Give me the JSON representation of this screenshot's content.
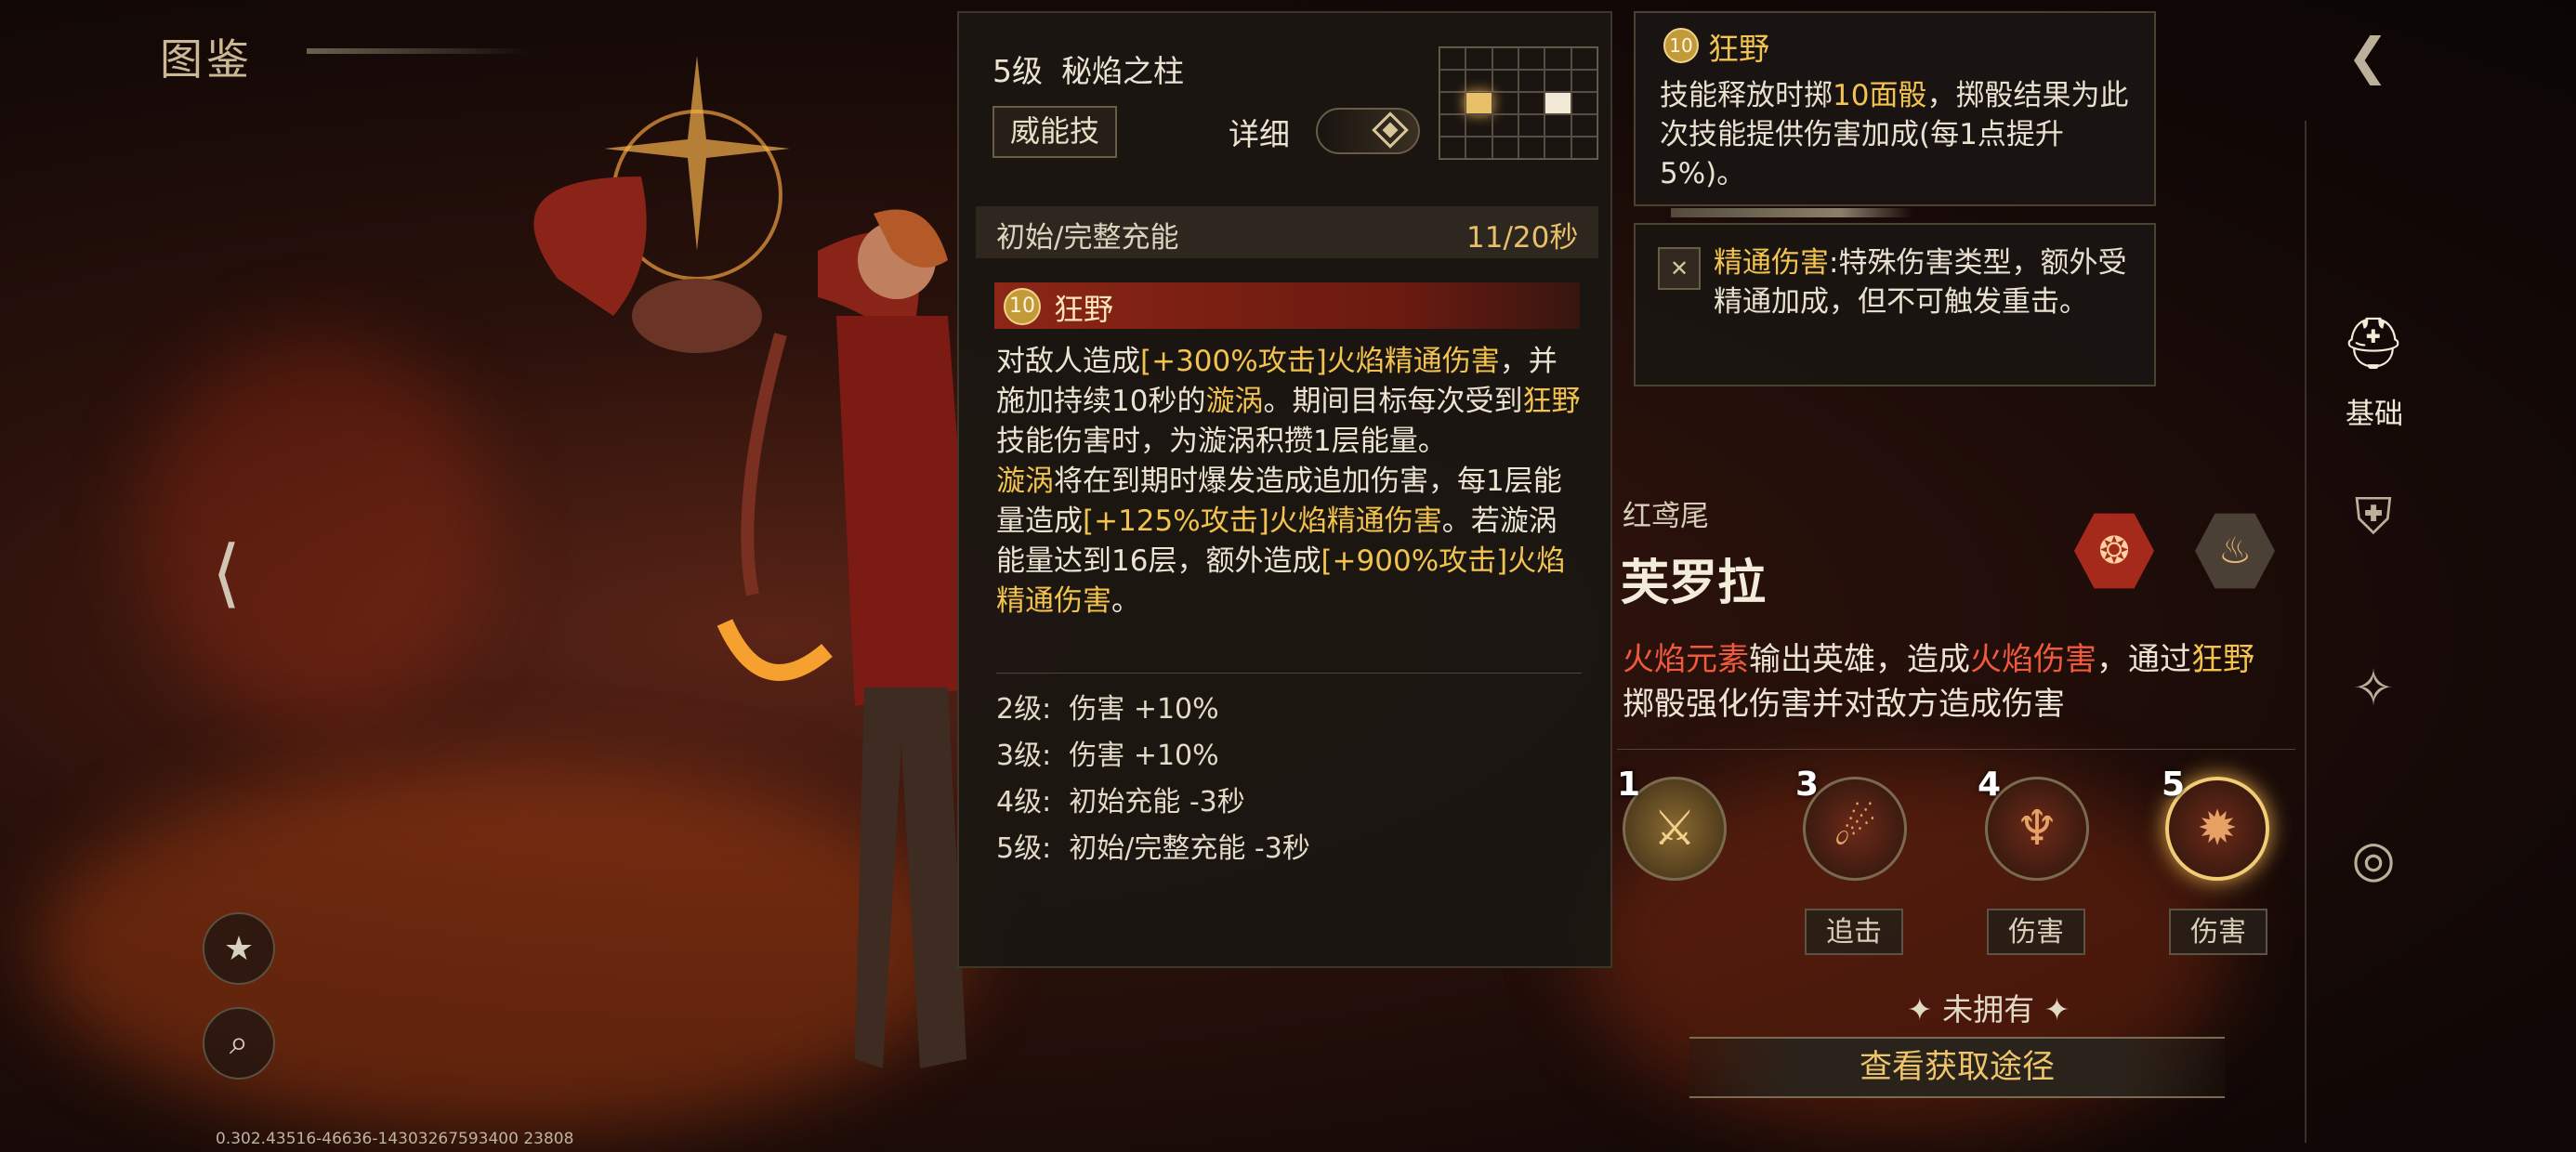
{
  "header": {
    "title": "图鉴"
  },
  "footer": {
    "build_id": "0.302.43516-46636-14303267593400 23808"
  },
  "skill_panel": {
    "level": "5级",
    "name": "秘焰之柱",
    "tag": "威能技",
    "detail_label": "详细",
    "charge_label": "初始/完整充能",
    "charge_value": "11/20秒",
    "skill_badge": "10",
    "skill_name": "狂野",
    "desc": {
      "p1a": "对敌人造成",
      "p1b": "[+300%攻击]火焰精通伤害",
      "p1c": "，并施加持续10秒的",
      "p1d": "漩涡",
      "p1e": "。期间目标每次受到",
      "p1f": "狂野",
      "p1g": "技能伤害时，为漩涡积攒1层能量。",
      "p2a": "漩涡",
      "p2b": "将在到期时爆发造成追加伤害，每1层能量造成",
      "p2c": "[+125%攻击]火焰精通伤害",
      "p2d": "。若漩涡能量达到16层，额外造成",
      "p2e": "[+900%攻击]火焰精通伤害",
      "p2f": "。"
    },
    "levels": [
      {
        "lv": "2级:",
        "text": "伤害 +10%"
      },
      {
        "lv": "3级:",
        "text": "伤害 +10%"
      },
      {
        "lv": "4级:",
        "text": "初始充能 -3秒"
      },
      {
        "lv": "5级:",
        "text": "初始/完整充能 -3秒"
      }
    ]
  },
  "tip_wild": {
    "badge": "10",
    "name": "狂野",
    "d1": "技能释放时掷",
    "d2": "10面骰",
    "d3": "，掷骰结果为此次技能提供伤害加成(每1点提升5%)。"
  },
  "tip_mastery": {
    "name": "精通伤害",
    "text": ":特殊伤害类型，额外受精通加成，但不可触发重击。"
  },
  "hero": {
    "subtitle": "红鸢尾",
    "name": "芙罗拉",
    "d1": "火焰元素",
    "d2": "输出英雄，造成",
    "d3": "火焰伤害",
    "d4": "，通过",
    "d5": "狂野",
    "d6": "掷骰强化伤害并对敌方造成伤害"
  },
  "talents": [
    {
      "num": "1",
      "tag": ""
    },
    {
      "num": "3",
      "tag": "追击"
    },
    {
      "num": "4",
      "tag": "伤害"
    },
    {
      "num": "5",
      "tag": "伤害"
    }
  ],
  "ownership": {
    "status": "未拥有",
    "button": "查看获取途径"
  },
  "right_nav": {
    "basic_label": "基础"
  },
  "colors": {
    "gold": "#f2c34e",
    "red": "#ef5a3c",
    "panel": "#1a1612"
  }
}
